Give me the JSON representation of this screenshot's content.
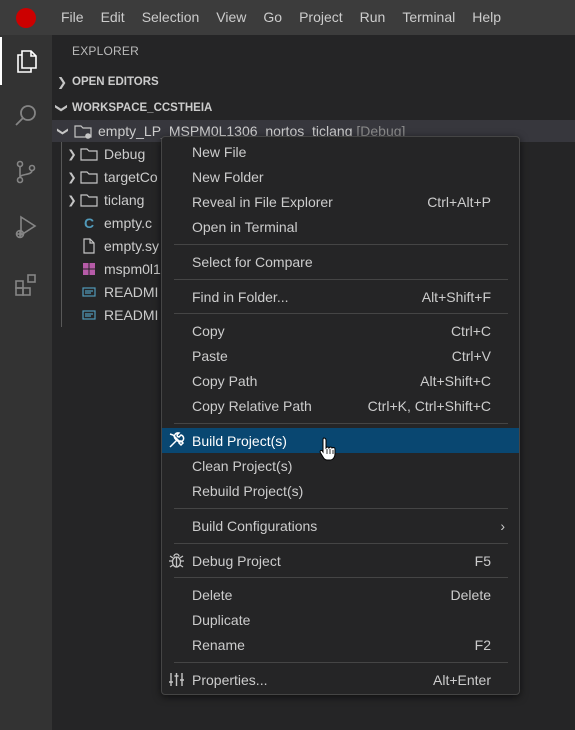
{
  "menubar": {
    "items": [
      "File",
      "Edit",
      "Selection",
      "View",
      "Go",
      "Project",
      "Run",
      "Terminal",
      "Help"
    ]
  },
  "activity_bar": {
    "icons": [
      "explorer-icon",
      "search-icon",
      "source-control-icon",
      "run-debug-icon",
      "extensions-icon"
    ]
  },
  "explorer": {
    "title": "EXPLORER",
    "open_editors": "OPEN EDITORS",
    "workspace": "WORKSPACE_CCSTHEIA",
    "root": {
      "name": "empty_LP_MSPM0L1306_nortos_ticlang",
      "tag": "[Debug]"
    },
    "items": [
      {
        "name": "Debug",
        "kind": "folder"
      },
      {
        "name": "targetCo",
        "kind": "folder"
      },
      {
        "name": "ticlang",
        "kind": "folder"
      },
      {
        "name": "empty.c",
        "kind": "c-file"
      },
      {
        "name": "empty.sy",
        "kind": "file"
      },
      {
        "name": "mspm0l1",
        "kind": "windows-file"
      },
      {
        "name": "READMI",
        "kind": "readme-file"
      },
      {
        "name": "READMI",
        "kind": "readme-file"
      }
    ]
  },
  "context_menu": {
    "new_file": "New File",
    "new_folder": "New Folder",
    "reveal": {
      "label": "Reveal in File Explorer",
      "key": "Ctrl+Alt+P"
    },
    "open_terminal": "Open in Terminal",
    "select_compare": "Select for Compare",
    "find_in_folder": {
      "label": "Find in Folder...",
      "key": "Alt+Shift+F"
    },
    "copy": {
      "label": "Copy",
      "key": "Ctrl+C"
    },
    "paste": {
      "label": "Paste",
      "key": "Ctrl+V"
    },
    "copy_path": {
      "label": "Copy Path",
      "key": "Alt+Shift+C"
    },
    "copy_relative_path": {
      "label": "Copy Relative Path",
      "key": "Ctrl+K, Ctrl+Shift+C"
    },
    "build_project": "Build Project(s)",
    "clean_project": "Clean Project(s)",
    "rebuild_project": "Rebuild Project(s)",
    "build_configurations": "Build Configurations",
    "debug_project": {
      "label": "Debug Project",
      "key": "F5"
    },
    "delete": {
      "label": "Delete",
      "key": "Delete"
    },
    "duplicate": "Duplicate",
    "rename": {
      "label": "Rename",
      "key": "F2"
    },
    "properties": {
      "label": "Properties...",
      "key": "Alt+Enter"
    }
  },
  "colors": {
    "highlight": "#094771",
    "logo": "#cc0000"
  }
}
